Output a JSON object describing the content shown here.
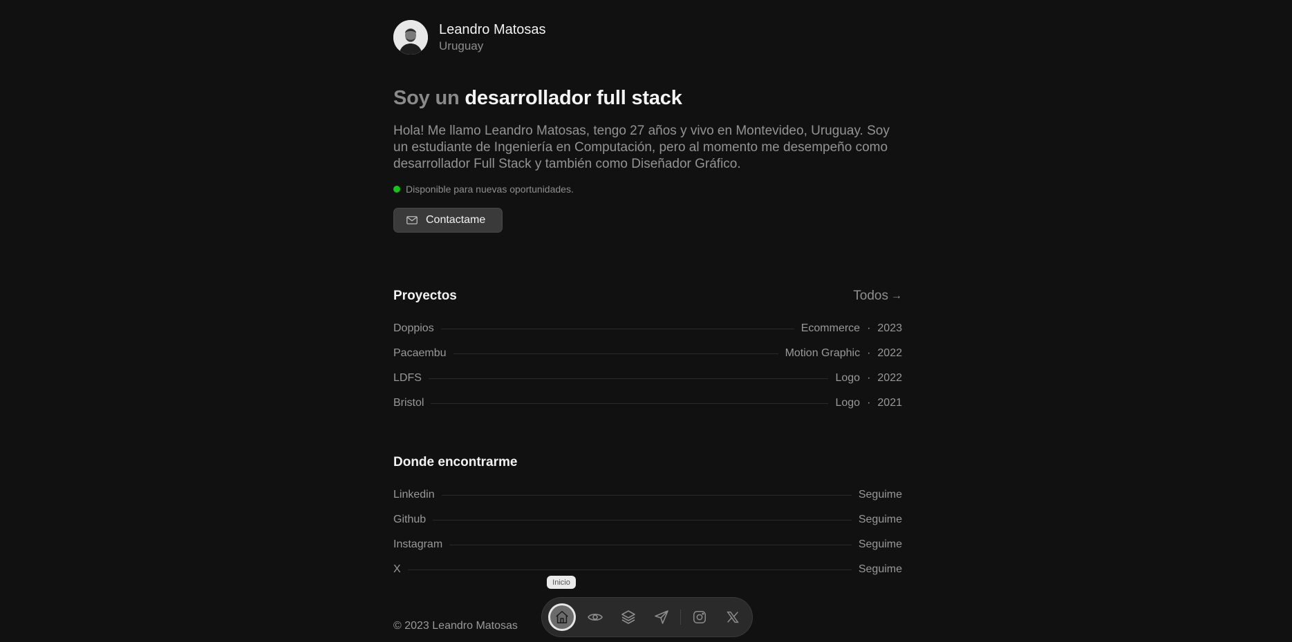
{
  "profile": {
    "name": "Leandro Matosas",
    "country": "Uruguay"
  },
  "headline": {
    "muted": "Soy un",
    "strong": "desarrollador full stack"
  },
  "intro": "Hola! Me llamo Leandro Matosas, tengo 27 años y vivo en Montevideo, Uruguay. Soy un estudiante de Ingeniería en Computación, pero al momento me desempeño como desarrollador Full Stack y también como Diseñador Gráfico.",
  "availability": {
    "text": "Disponible para nuevas oportunidades.",
    "color": "#16c419"
  },
  "contact_button": {
    "label": "Contactame",
    "icon": "mail-icon"
  },
  "projects": {
    "title": "Proyectos",
    "all_link": "Todos",
    "items": [
      {
        "name": "Doppios",
        "category": "Ecommerce",
        "year": "2023"
      },
      {
        "name": "Pacaembu",
        "category": "Motion Graphic",
        "year": "2022"
      },
      {
        "name": "LDFS",
        "category": "Logo",
        "year": "2022"
      },
      {
        "name": "Bristol",
        "category": "Logo",
        "year": "2021"
      }
    ]
  },
  "socials": {
    "title": "Donde encontrarme",
    "items": [
      {
        "name": "Linkedin",
        "action": "Seguime"
      },
      {
        "name": "Github",
        "action": "Seguime"
      },
      {
        "name": "Instagram",
        "action": "Seguime"
      },
      {
        "name": "X",
        "action": "Seguime"
      }
    ]
  },
  "footer": "© 2023 Leandro Matosas",
  "dock": {
    "tooltip": "Inicio",
    "items": [
      "home-icon",
      "eye-icon",
      "layers-icon",
      "send-icon",
      "instagram-icon",
      "x-icon"
    ]
  }
}
